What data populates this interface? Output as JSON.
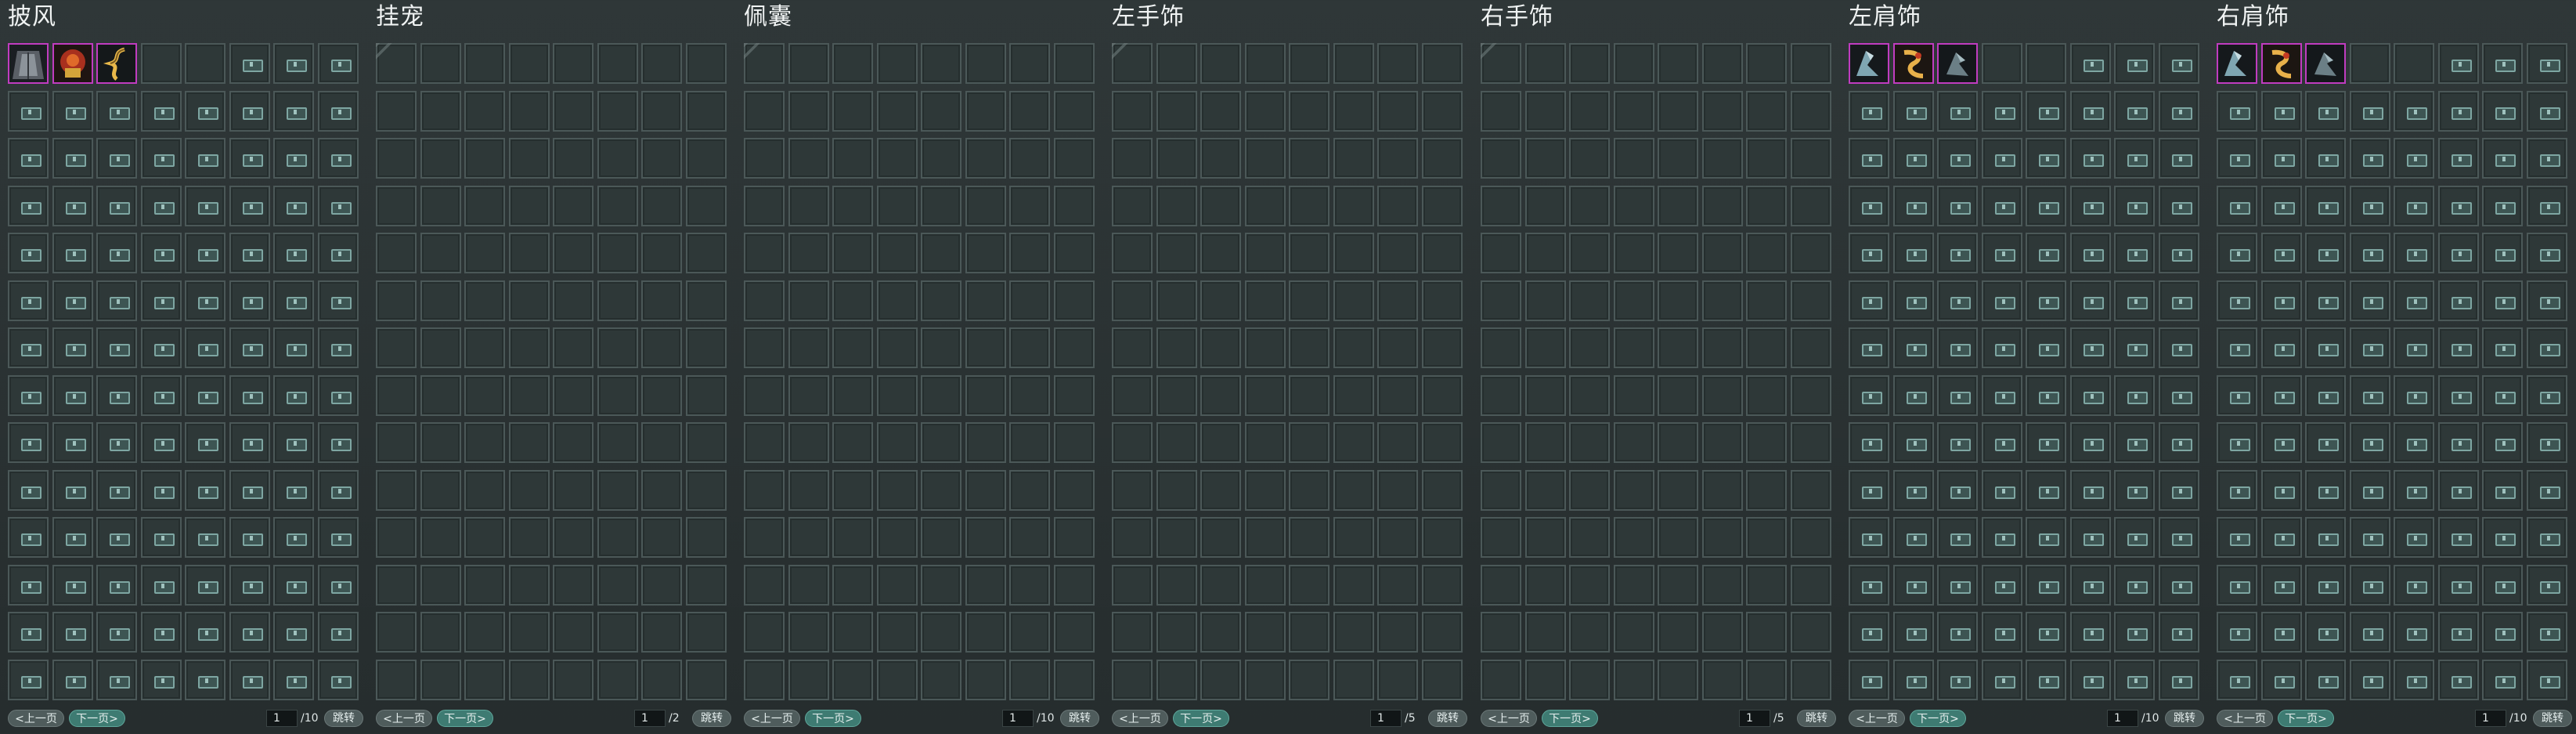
{
  "panels": [
    {
      "id": "cape",
      "title": "披风",
      "page": "1",
      "total": "/10",
      "locked": true,
      "items": [
        "cape-dark",
        "cape-red",
        "cape-gold"
      ]
    },
    {
      "id": "pet",
      "title": "挂宠",
      "page": "1",
      "total": "/2",
      "locked": false,
      "items": []
    },
    {
      "id": "pouch",
      "title": "佩囊",
      "page": "1",
      "total": "/10",
      "locked": false,
      "items": []
    },
    {
      "id": "left-hand",
      "title": "左手饰",
      "page": "1",
      "total": "/5",
      "locked": false,
      "items": []
    },
    {
      "id": "right-hand",
      "title": "右手饰",
      "page": "1",
      "total": "/5",
      "locked": false,
      "items": []
    },
    {
      "id": "left-shoulder",
      "title": "左肩饰",
      "page": "1",
      "total": "/10",
      "locked": true,
      "items": [
        "shoulder-blue",
        "shoulder-gold",
        "shoulder-dark"
      ]
    },
    {
      "id": "right-shoulder",
      "title": "右肩饰",
      "page": "1",
      "total": "/10",
      "locked": true,
      "items": [
        "shoulder-blue",
        "shoulder-gold",
        "shoulder-dark"
      ]
    }
  ],
  "labels": {
    "prev": "<上一页",
    "next": "下一页>",
    "jump": "跳转"
  },
  "colors": {
    "item_border": "#c03cc0",
    "next_button": "#3e7b72",
    "slot_border": "#4b5858"
  }
}
